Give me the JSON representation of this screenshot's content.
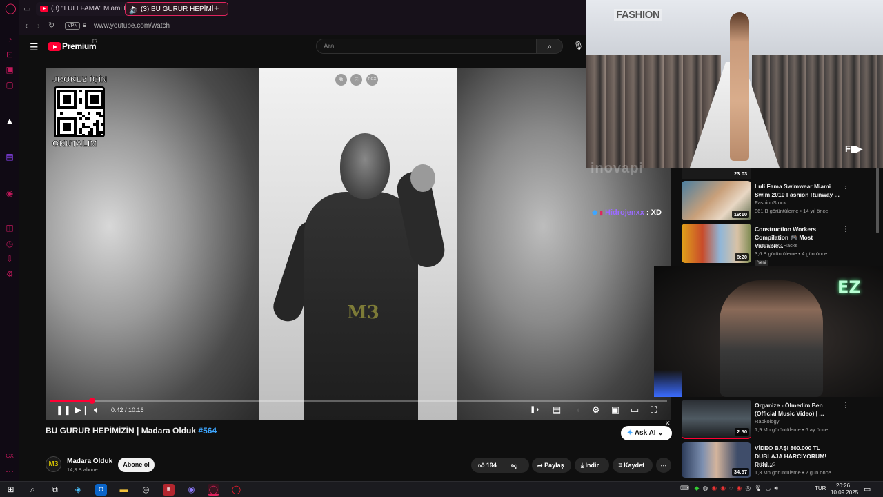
{
  "colors": {
    "accent": "#ff0033",
    "opera_red": "#c2185b",
    "hashtag_blue": "#3ea6ff",
    "chat_user": "#9b6bff"
  },
  "browser": {
    "tabs": [
      {
        "label": "(3) \"LULI FAMA\" Miami Fa"
      },
      {
        "label": "(3) BU GURUR HEPİMİ"
      }
    ],
    "new_tab": "+",
    "vpn": "VPN",
    "url": "www.youtube.com/watch"
  },
  "youtube": {
    "logo_text": "Premium",
    "logo_sup": "TR",
    "search_placeholder": "Ara"
  },
  "player": {
    "qr_top_text": "JROKEZ İÇİN",
    "qr_bottom_text": "OKUTALIM",
    "watermark": "M3",
    "overlay_buttons": [
      "⧉",
      "⎘",
      "RGX"
    ],
    "time": "0:42 / 10:16",
    "progress": 0.069
  },
  "video": {
    "title": "BU GURUR HEPİMİZİN | Madara Olduk",
    "hashtag": "#564",
    "ask_ai": "Ask AI",
    "channel_initials": "M3",
    "channel_name": "Madara Olduk",
    "subscribers": "14,3 B abone",
    "subscribe": "Abone ol",
    "likes": "194",
    "share": "Paylaş",
    "download": "İndir",
    "save": "Kaydet"
  },
  "fashion": {
    "logo": "FASHION",
    "corner_logo": "F▮▶"
  },
  "overlay": {
    "watermark_text": "inovapi",
    "chat_user": "Hidrojenxx",
    "chat_message": ": XD"
  },
  "recommendations": {
    "top_duration": "23:03",
    "items": [
      {
        "title": "Luli Fama Swimwear Miami Swim 2010 Fashion Runway ...",
        "channel": "FashionStock",
        "meta": "861 B görüntüleme • 14 yıl önce",
        "duration": "19:10",
        "badge": ""
      },
      {
        "title": "Construction Workers Compilation 🎮 Most Valuable...",
        "channel": "Smart Work Hacks",
        "meta": "3,6 B görüntüleme • 4 gün önce",
        "duration": "8:20",
        "badge": "Yeni"
      },
      {
        "title": "Organize - Ölmedim Ben (Official Music Video) | ...",
        "channel": "Rapkology",
        "meta": "1,9 Mn görüntüleme • 6 ay önce",
        "duration": "2:50",
        "badge": ""
      },
      {
        "title": "VİDEO BAŞI 800.000 TL DUBLAJA HARCIYORUM! Ruhi...",
        "channel": "Orkun v2",
        "meta": "1,3 Mn görüntüleme • 2 gün önce",
        "duration": "34:57",
        "badge": ""
      }
    ]
  },
  "webcam": {
    "ez_text": "EZ"
  },
  "taskbar": {
    "language": "TUR",
    "time": "20:26",
    "date": "10.09.2025"
  }
}
